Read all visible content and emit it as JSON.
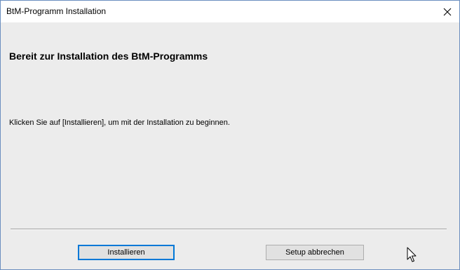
{
  "window": {
    "title": "BtM-Programm Installation",
    "close_icon": "close-icon"
  },
  "content": {
    "heading": "Bereit zur Installation des BtM-Programms",
    "message": "Klicken Sie auf [Installieren], um mit der Installation zu beginnen."
  },
  "buttons": {
    "install_label": "Installieren",
    "cancel_label": "Setup abbrechen"
  },
  "colors": {
    "accent": "#0078d7",
    "window_border": "#6b8fbf",
    "dialog_background": "#ececec"
  },
  "icons": {
    "cursor": "mouse-pointer-icon"
  }
}
